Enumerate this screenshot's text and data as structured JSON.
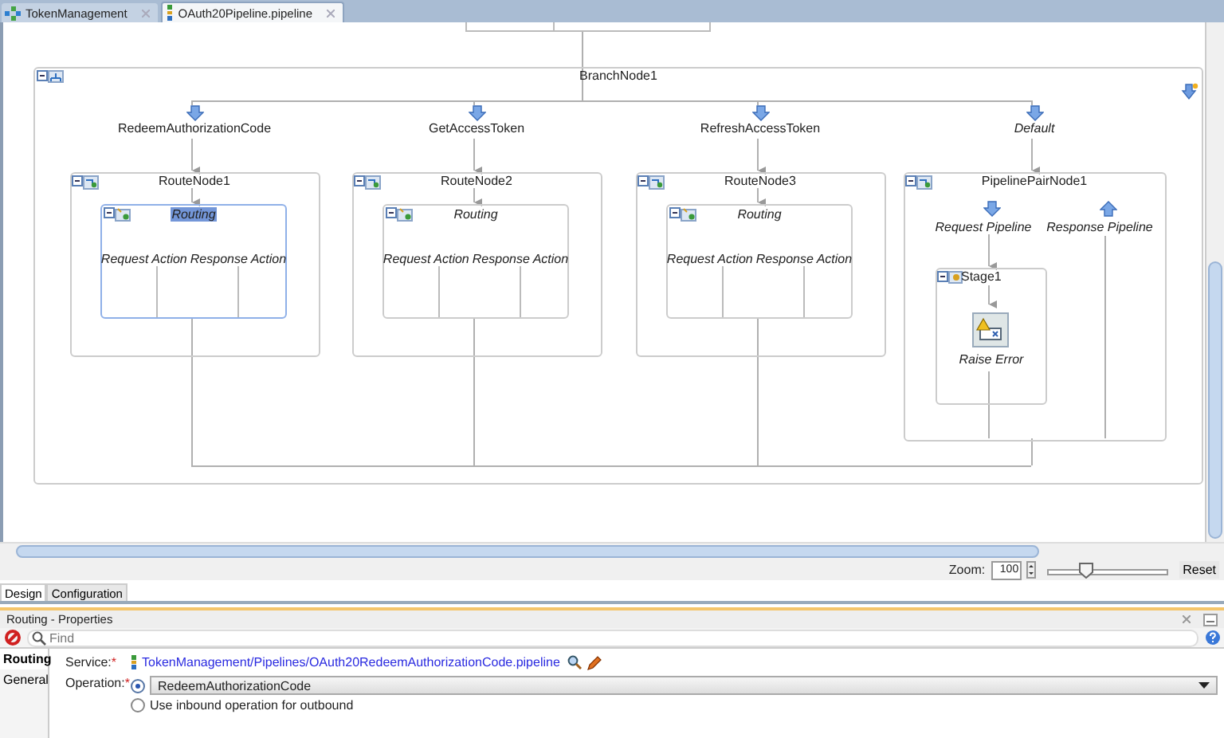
{
  "editor_tabs": [
    {
      "label": "TokenManagement",
      "selected": false
    },
    {
      "label": "OAuth20Pipeline.pipeline",
      "selected": true
    }
  ],
  "branch_node": {
    "title": "BranchNode1",
    "branches": [
      {
        "label": "RedeemAuthorizationCode",
        "kind": "operation",
        "node": {
          "kind": "route",
          "title": "RouteNode1",
          "routing": {
            "label": "Routing",
            "selected": true
          },
          "actions": [
            "Request Action",
            "Response Action"
          ]
        }
      },
      {
        "label": "GetAccessToken",
        "kind": "operation",
        "node": {
          "kind": "route",
          "title": "RouteNode2",
          "routing": {
            "label": "Routing",
            "selected": false
          },
          "actions": [
            "Request Action",
            "Response Action"
          ]
        }
      },
      {
        "label": "RefreshAccessToken",
        "kind": "operation",
        "node": {
          "kind": "route",
          "title": "RouteNode3",
          "routing": {
            "label": "Routing",
            "selected": false
          },
          "actions": [
            "Request Action",
            "Response Action"
          ]
        }
      },
      {
        "label": "Default",
        "kind": "default",
        "node": {
          "kind": "pipeline_pair",
          "title": "PipelinePairNode1",
          "request": "Request Pipeline",
          "response": "Response Pipeline",
          "stage": {
            "title": "Stage1",
            "action": "Raise Error"
          }
        }
      }
    ]
  },
  "zoom": {
    "label": "Zoom:",
    "value": "100",
    "level": 0.32,
    "reset": "Reset"
  },
  "view_tabs": [
    {
      "label": "Design",
      "selected": true
    },
    {
      "label": "Configuration",
      "selected": false
    }
  ],
  "properties": {
    "title": "Routing - Properties",
    "find_placeholder": "Find",
    "side_tabs": [
      {
        "label": "Routing",
        "selected": true
      },
      {
        "label": "General",
        "selected": false
      }
    ],
    "service": {
      "label": "Service:",
      "mark": "*",
      "value": "TokenManagement/Pipelines/OAuth20RedeemAuthorizationCode.pipeline"
    },
    "operation": {
      "label": "Operation:",
      "mark": "*",
      "options": [
        {
          "kind": "dropdown",
          "label": "RedeemAuthorizationCode",
          "selected": true
        },
        {
          "kind": "text",
          "label": "Use inbound operation for outbound",
          "selected": false
        }
      ]
    }
  }
}
